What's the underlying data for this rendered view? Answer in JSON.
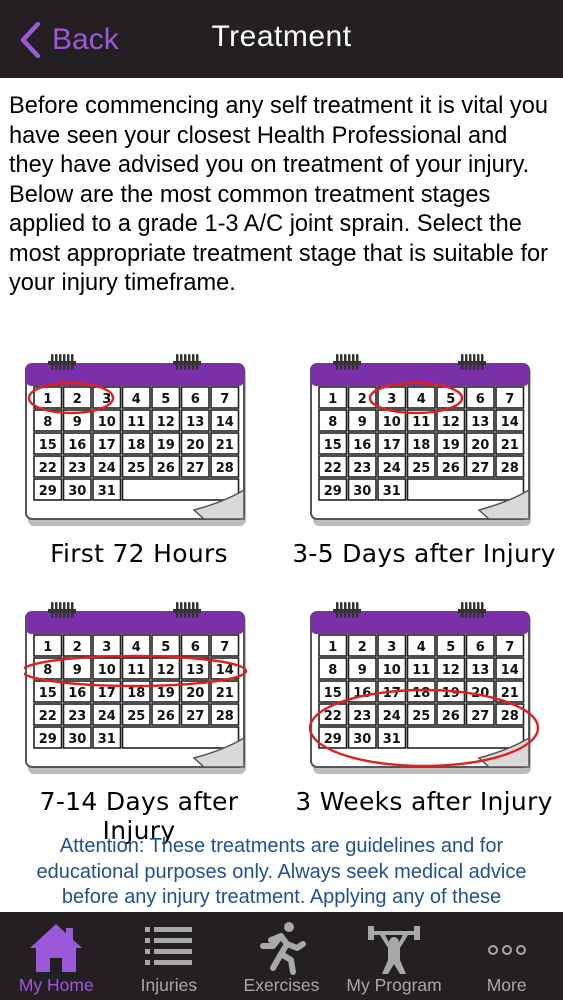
{
  "header": {
    "back_label": "Back",
    "title": "Treatment"
  },
  "intro_text": "Before commencing any self treatment it is vital you have seen your closest Health Professional and they have advised you on treatment of your injury. Below are the most common treatment stages applied to a grade 1-3 A/C joint sprain. Select the most appropriate treatment stage that is suitable for your injury timeframe.",
  "calendar_days": [
    "1",
    "2",
    "3",
    "4",
    "5",
    "6",
    "7",
    "8",
    "9",
    "10",
    "11",
    "12",
    "13",
    "14",
    "15",
    "16",
    "17",
    "18",
    "19",
    "20",
    "21",
    "22",
    "23",
    "24",
    "25",
    "26",
    "27",
    "28",
    "29",
    "30",
    "31"
  ],
  "stages": [
    {
      "caption": "First 72 Hours",
      "highlighted_days": "1-3"
    },
    {
      "caption": "3-5 Days after Injury",
      "highlighted_days": "3-5"
    },
    {
      "caption": "7-14 Days after Injury",
      "highlighted_days": "8-14"
    },
    {
      "caption": "3 Weeks after Injury",
      "highlighted_days": "15-28"
    }
  ],
  "attention_text": "Attention: These treatments are guidelines and for educational purposes only. Always seek medical advice before any injury treatment. Applying any of these",
  "tabs": [
    {
      "label": "My Home",
      "icon": "home-icon",
      "active": true
    },
    {
      "label": "Injuries",
      "icon": "list-icon",
      "active": false
    },
    {
      "label": "Exercises",
      "icon": "running-person-icon",
      "active": false
    },
    {
      "label": "My Program",
      "icon": "weightlifter-icon",
      "active": false
    },
    {
      "label": "More",
      "icon": "more-dots-icon",
      "active": false
    }
  ],
  "colors": {
    "header_bg": "#231f23",
    "accent_purple": "#9b59d9",
    "calendar_purple": "#7b2fa8",
    "highlight_red": "#e02020",
    "attention_blue": "#1f4f99",
    "tab_inactive": "#a8a8a8"
  }
}
